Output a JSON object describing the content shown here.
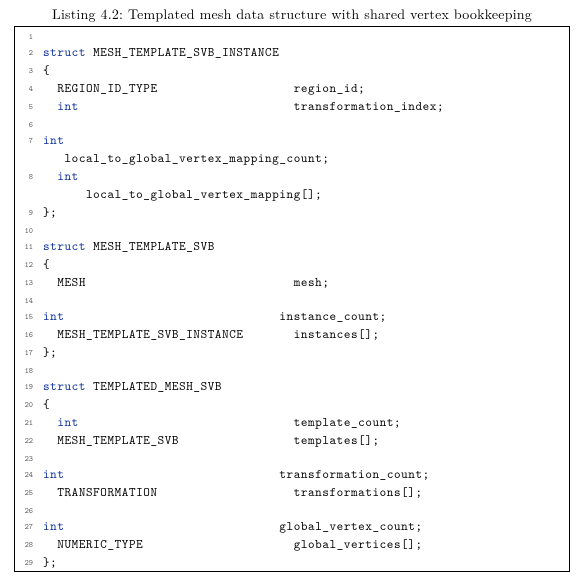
{
  "caption": "Listing 4.2: Templated mesh data structure with shared vertex bookkeeping",
  "lines": [
    {
      "n": 1,
      "kw": "",
      "rest": ""
    },
    {
      "n": 2,
      "kw": "struct",
      "rest": " MESH_TEMPLATE_SVB_INSTANCE"
    },
    {
      "n": 3,
      "kw": "",
      "rest": "{"
    },
    {
      "n": 4,
      "kw": "",
      "rest": "  REGION_ID_TYPE                   region_id;"
    },
    {
      "n": 5,
      "kw": "  int",
      "rest": "                              transformation_index;"
    },
    {
      "n": 6,
      "kw": "",
      "rest": ""
    },
    {
      "n": 7,
      "kw": "int",
      "rest": "\n   local_to_global_vertex_mapping_count;"
    },
    {
      "n": 8,
      "kw": "  int",
      "rest": "\n      local_to_global_vertex_mapping[];"
    },
    {
      "n": 9,
      "kw": "",
      "rest": "};"
    },
    {
      "n": 10,
      "kw": "",
      "rest": ""
    },
    {
      "n": 11,
      "kw": "struct",
      "rest": " MESH_TEMPLATE_SVB"
    },
    {
      "n": 12,
      "kw": "",
      "rest": "{"
    },
    {
      "n": 13,
      "kw": "",
      "rest": "  MESH                             mesh;"
    },
    {
      "n": 14,
      "kw": "",
      "rest": ""
    },
    {
      "n": 15,
      "kw": "int",
      "rest": "                              instance_count;"
    },
    {
      "n": 16,
      "kw": "",
      "rest": "  MESH_TEMPLATE_SVB_INSTANCE       instances[];"
    },
    {
      "n": 17,
      "kw": "",
      "rest": "};"
    },
    {
      "n": 18,
      "kw": "",
      "rest": ""
    },
    {
      "n": 19,
      "kw": "struct",
      "rest": " TEMPLATED_MESH_SVB"
    },
    {
      "n": 20,
      "kw": "",
      "rest": "{"
    },
    {
      "n": 21,
      "kw": "  int",
      "rest": "                              template_count;"
    },
    {
      "n": 22,
      "kw": "",
      "rest": "  MESH_TEMPLATE_SVB                templates[];"
    },
    {
      "n": 23,
      "kw": "",
      "rest": ""
    },
    {
      "n": 24,
      "kw": "int",
      "rest": "                              transformation_count;"
    },
    {
      "n": 25,
      "kw": "",
      "rest": "  TRANSFORMATION                   transformations[];"
    },
    {
      "n": 26,
      "kw": "",
      "rest": ""
    },
    {
      "n": 27,
      "kw": "int",
      "rest": "                              global_vertex_count;"
    },
    {
      "n": 28,
      "kw": "",
      "rest": "  NUMERIC_TYPE                     global_vertices[];"
    },
    {
      "n": 29,
      "kw": "",
      "rest": "};"
    }
  ]
}
